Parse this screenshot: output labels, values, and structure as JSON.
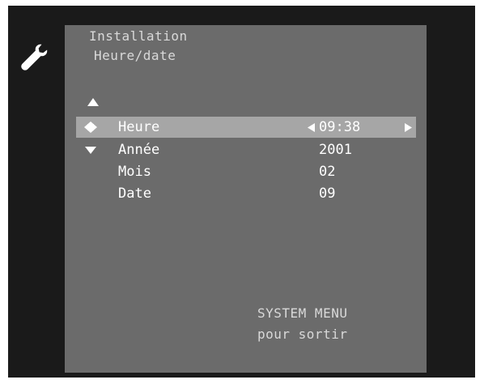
{
  "icons": {
    "settings": "wrench-icon",
    "scroll_up": "triangle-up-icon",
    "selected_marker": "diamond-icon",
    "scroll_down": "triangle-down-icon",
    "decrease": "triangle-left-icon",
    "increase": "triangle-right-icon"
  },
  "colors": {
    "outer_background": "#1a1a1a",
    "panel_background": "#6b6b6b",
    "highlight": "#a6a6a6",
    "text": "#ffffff",
    "dim_text": "#d9d9d9"
  },
  "breadcrumb": {
    "level1": "Installation",
    "level2": "Heure/date"
  },
  "menu": {
    "items": [
      {
        "label": "Heure",
        "value": "09:38",
        "selected": true
      },
      {
        "label": "Année",
        "value": "2001",
        "selected": false
      },
      {
        "label": "Mois",
        "value": "02",
        "selected": false
      },
      {
        "label": "Date",
        "value": "09",
        "selected": false
      }
    ]
  },
  "footer": {
    "line1": "SYSTEM MENU",
    "line2": "pour sortir"
  }
}
